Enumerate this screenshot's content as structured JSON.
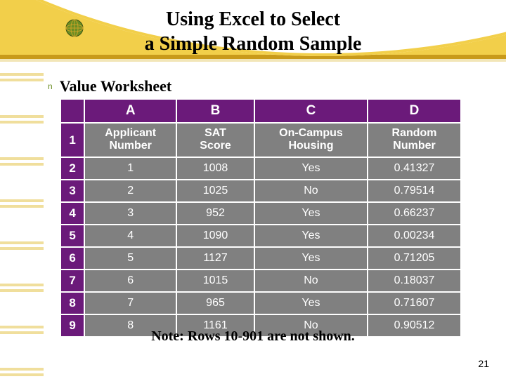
{
  "title_line1": "Using Excel to Select",
  "title_line2": "a Simple Random Sample",
  "bullet_marker": "n",
  "bullet_label": "Value Worksheet",
  "columns": {
    "A": "A",
    "B": "B",
    "C": "C",
    "D": "D"
  },
  "subheaders": {
    "A": "Applicant\nNumber",
    "B": "SAT\nScore",
    "C": "On-Campus\nHousing",
    "D": "Random\nNumber"
  },
  "chart_data": {
    "type": "table",
    "title": "Value Worksheet",
    "columns": [
      "Applicant Number",
      "SAT Score",
      "On-Campus Housing",
      "Random Number"
    ],
    "rows": [
      {
        "row": 2,
        "applicant": 1,
        "sat": 1008,
        "housing": "Yes",
        "rand": 0.41327
      },
      {
        "row": 3,
        "applicant": 2,
        "sat": 1025,
        "housing": "No",
        "rand": 0.79514
      },
      {
        "row": 4,
        "applicant": 3,
        "sat": 952,
        "housing": "Yes",
        "rand": 0.66237
      },
      {
        "row": 5,
        "applicant": 4,
        "sat": 1090,
        "housing": "Yes",
        "rand": 0.00234
      },
      {
        "row": 6,
        "applicant": 5,
        "sat": 1127,
        "housing": "Yes",
        "rand": 0.71205
      },
      {
        "row": 7,
        "applicant": 6,
        "sat": 1015,
        "housing": "No",
        "rand": 0.18037
      },
      {
        "row": 8,
        "applicant": 7,
        "sat": 965,
        "housing": "Yes",
        "rand": 0.71607
      },
      {
        "row": 9,
        "applicant": 8,
        "sat": 1161,
        "housing": "No",
        "rand": 0.90512
      }
    ]
  },
  "note": "Note:  Rows 10-901 are not shown.",
  "page_number": "21"
}
